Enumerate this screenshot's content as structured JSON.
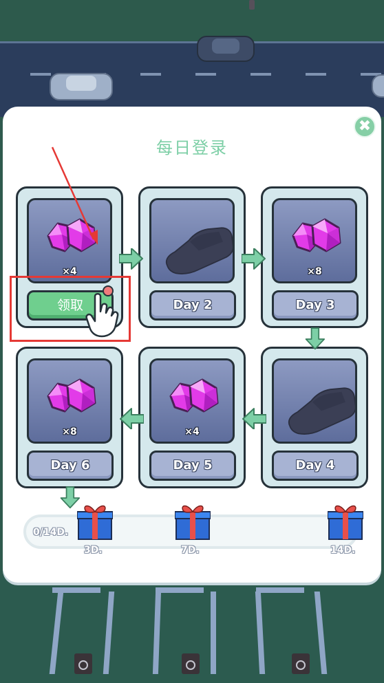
{
  "dialog": {
    "title": "每日登录",
    "close_icon": "close-icon"
  },
  "cards": [
    {
      "reward": "gem",
      "quantity": "×4",
      "action_label": "领取",
      "claimable": true
    },
    {
      "reward": "car-silhouette",
      "day_label": "Day 2"
    },
    {
      "reward": "gem",
      "quantity": "×8",
      "day_label": "Day 3"
    },
    {
      "reward": "car-silhouette",
      "day_label": "Day 4"
    },
    {
      "reward": "gem",
      "quantity": "×4",
      "day_label": "Day 5"
    },
    {
      "reward": "gem",
      "quantity": "×8",
      "day_label": "Day 6"
    }
  ],
  "progress": {
    "text": "0/14D.",
    "value": 0,
    "max": 14,
    "milestones": [
      {
        "label": "3D.",
        "icon": "gift-box-icon"
      },
      {
        "label": "7D.",
        "icon": "gift-box-icon"
      },
      {
        "label": "14D.",
        "icon": "gift-box-icon"
      }
    ]
  },
  "colors": {
    "accent_green": "#7dcfa6",
    "claim_green": "#6fcf8e",
    "gem_magenta": "#e23be8",
    "highlight_red": "#e53935",
    "card_bg": "#d4e8ec"
  }
}
